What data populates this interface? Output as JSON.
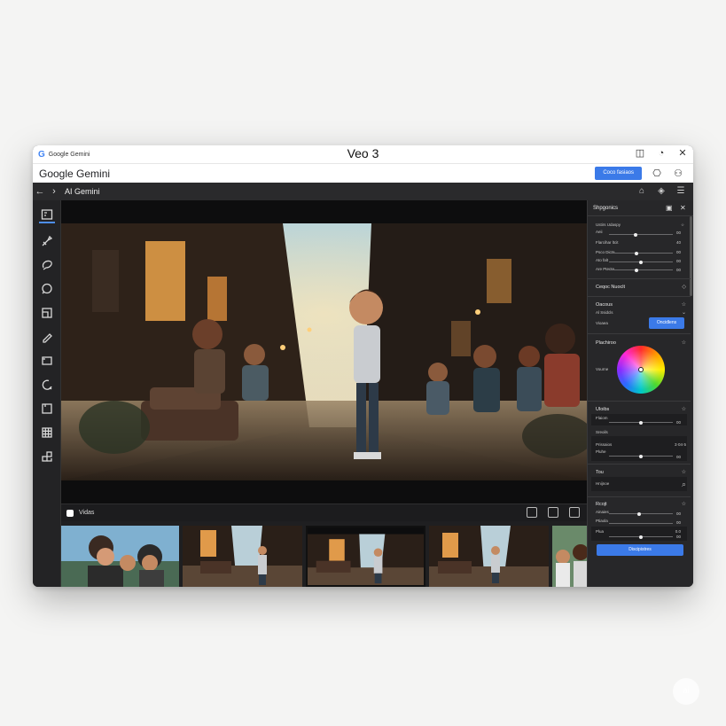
{
  "titlebar": {
    "logo": "G",
    "small_label": "Google Gemini",
    "title": "Veo 3"
  },
  "appbar": {
    "name": "Google Gemini",
    "primary_button": "Coco fasiaos"
  },
  "navbar": {
    "title": "AI Gemini"
  },
  "timeline": {
    "label": "Vidas"
  },
  "panel": {
    "header": "Shpgonics",
    "sec1": {
      "rows": [
        {
          "label": "Ustirs Udaspy",
          "value": "☆"
        },
        {
          "label": "Aeii",
          "value": "00"
        },
        {
          "label": "Flarcihar ltcit",
          "value": "40"
        },
        {
          "label": "Psco  Dicta",
          "value": "00"
        },
        {
          "label": "Ato  falt",
          "value": "00"
        },
        {
          "label": "Are  Ptecte",
          "value": "00"
        }
      ]
    },
    "sec2": {
      "title": "Ceqoc Nuoclt",
      "icon": "◇"
    },
    "sec3": {
      "title": "Oacous",
      "sub": "Al Ssidcls",
      "row_label": "Vioaea",
      "button": "Oncidlens"
    },
    "sec4": {
      "title": "Plachiroo",
      "wheel_label": "Vourne"
    },
    "sec5": {
      "title": "Uloibs",
      "rows": [
        {
          "label": "Flaiom",
          "value": "00"
        },
        {
          "label": "Sreoils",
          "value": ""
        },
        {
          "label": "Prissaios",
          "value": "3·04·5"
        },
        {
          "label": "Pluhe",
          "value": "00"
        }
      ]
    },
    "sec6": {
      "title": "Tou",
      "search_label": "Hnijnoe"
    },
    "sec7": {
      "title": "Rcojt",
      "rows": [
        {
          "label": "Ainaies",
          "value": "00"
        },
        {
          "label": "Ptiaola",
          "value": "00"
        },
        {
          "label": "Plua",
          "value": "0.0"
        },
        {
          "label": "",
          "value": "00"
        }
      ]
    },
    "bottom_button": "Discipistres"
  },
  "watermark": "ai",
  "colors": {
    "accent": "#3b7ae8",
    "panel_bg": "#272729",
    "window_bg": "#1f1f21"
  }
}
